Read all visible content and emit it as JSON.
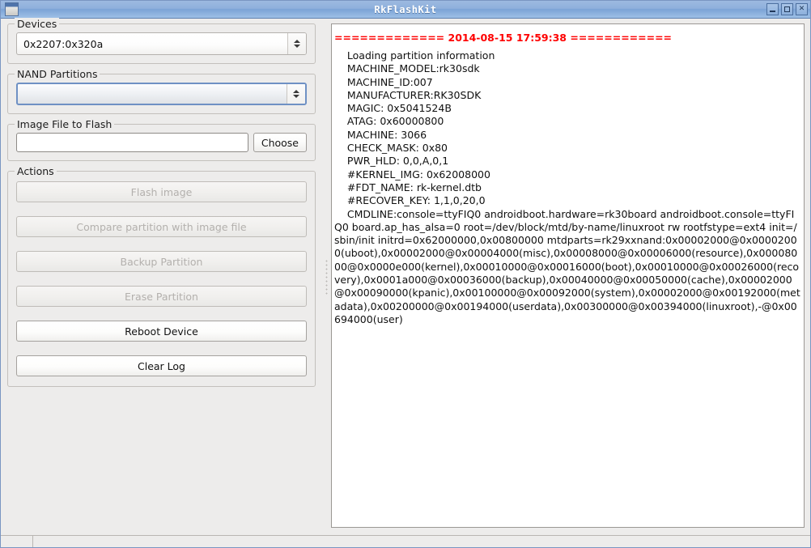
{
  "window": {
    "title": "RkFlashKit",
    "icon": "window-icon",
    "buttons": [
      {
        "name": "minimize",
        "glyph": "−"
      },
      {
        "name": "maximize",
        "glyph": "□"
      },
      {
        "name": "close",
        "glyph": "✕"
      }
    ]
  },
  "colors": {
    "titlebar_blue": "#8fb0dc",
    "log_header_red": "#fe0000",
    "focus_border_blue": "#6f91c4",
    "window_bg": "#edeceb",
    "disabled_text": "#b3b0ad"
  },
  "devices": {
    "group_label": "Devices",
    "selected": "0x2207:0x320a",
    "options": [
      "0x2207:0x320a"
    ]
  },
  "nand_partitions": {
    "group_label": "NAND Partitions",
    "selected": "",
    "options": []
  },
  "image_file": {
    "group_label": "Image File to Flash",
    "value": "",
    "placeholder": "",
    "choose_label": "Choose"
  },
  "actions": {
    "group_label": "Actions",
    "buttons": [
      {
        "label": "Flash image",
        "enabled": false
      },
      {
        "label": "Compare partition with image file",
        "enabled": false
      },
      {
        "label": "Backup Partition",
        "enabled": false
      },
      {
        "label": "Erase Partition",
        "enabled": false
      },
      {
        "label": "Reboot Device",
        "enabled": true
      },
      {
        "label": "Clear Log",
        "enabled": true
      }
    ]
  },
  "log": {
    "header": "============= 2014-08-15 17:59:38 ============",
    "timestamp": "2014-08-15 17:59:38",
    "lines": [
      "Loading partition information",
      "MACHINE_MODEL:rk30sdk",
      "MACHINE_ID:007",
      "MANUFACTURER:RK30SDK",
      "MAGIC: 0x5041524B",
      "ATAG: 0x60000800",
      "MACHINE: 3066",
      "CHECK_MASK: 0x80",
      "PWR_HLD: 0,0,A,0,1",
      "#KERNEL_IMG: 0x62008000",
      "#FDT_NAME: rk-kernel.dtb",
      "#RECOVER_KEY: 1,1,0,20,0"
    ],
    "cmdline": "CMDLINE:console=ttyFIQ0 androidboot.hardware=rk30board androidboot.console=ttyFIQ0 board.ap_has_alsa=0 root=/dev/block/mtd/by-name/linuxroot rw rootfstype=ext4 init=/sbin/init initrd=0x62000000,0x00800000 mtdparts=rk29xxnand:0x00002000@0x00002000(uboot),0x00002000@0x00004000(misc),0x00008000@0x00006000(resource),0x00008000@0x0000e000(kernel),0x00010000@0x00016000(boot),0x00010000@0x00026000(recovery),0x0001a000@0x00036000(backup),0x00040000@0x00050000(cache),0x00002000@0x00090000(kpanic),0x00100000@0x00092000(system),0x00002000@0x00192000(metadata),0x00200000@0x00194000(userdata),0x00300000@0x00394000(linuxroot),-@0x00694000(user)"
  }
}
